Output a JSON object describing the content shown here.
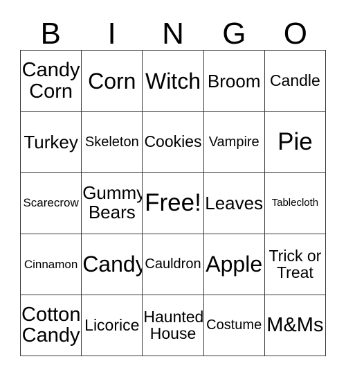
{
  "card": {
    "title_letters": [
      "B",
      "I",
      "N",
      "G",
      "O"
    ],
    "background_color": "#ffffff",
    "border_color": "#3a3a3a",
    "text_color": "#000000",
    "rows": 5,
    "columns": 5,
    "free_space": {
      "row": 3,
      "column": 3,
      "label": "Free!"
    },
    "cells": [
      [
        {
          "text": "Candy\nCorn",
          "size": "lg",
          "lines": 2
        },
        {
          "text": "Corn",
          "size": "xl",
          "lines": 1
        },
        {
          "text": "Witch",
          "size": "xl",
          "lines": 1
        },
        {
          "text": "Broom",
          "size": "md",
          "lines": 1
        },
        {
          "text": "Candle",
          "size": "sm",
          "lines": 1
        }
      ],
      [
        {
          "text": "Turkey",
          "size": "md",
          "lines": 1
        },
        {
          "text": "Skeleton",
          "size": "xs",
          "lines": 1
        },
        {
          "text": "Cookies",
          "size": "sm",
          "lines": 1
        },
        {
          "text": "Vampire",
          "size": "xs",
          "lines": 1
        },
        {
          "text": "Pie",
          "size": "xxl",
          "lines": 1
        }
      ],
      [
        {
          "text": "Scarecrow",
          "size": "xxs",
          "lines": 1
        },
        {
          "text": "Gummy\nBears",
          "size": "md",
          "lines": 2
        },
        {
          "text": "Free!",
          "size": "xxl",
          "lines": 1
        },
        {
          "text": "Leaves",
          "size": "md",
          "lines": 1
        },
        {
          "text": "Tablecloth",
          "size": "tiny",
          "lines": 1
        }
      ],
      [
        {
          "text": "Cinnamon",
          "size": "xxs",
          "lines": 1
        },
        {
          "text": "Candy",
          "size": "xl",
          "lines": 1
        },
        {
          "text": "Cauldron",
          "size": "xs",
          "lines": 1
        },
        {
          "text": "Apple",
          "size": "xl",
          "lines": 1
        },
        {
          "text": "Trick or\nTreat",
          "size": "sm",
          "lines": 2
        }
      ],
      [
        {
          "text": "Cotton\nCandy",
          "size": "lg",
          "lines": 2
        },
        {
          "text": "Licorice",
          "size": "sm",
          "lines": 1
        },
        {
          "text": "Haunted\nHouse",
          "size": "sm",
          "lines": 2
        },
        {
          "text": "Costume",
          "size": "xs",
          "lines": 1
        },
        {
          "text": "M&Ms",
          "size": "lg",
          "lines": 1
        }
      ]
    ]
  }
}
